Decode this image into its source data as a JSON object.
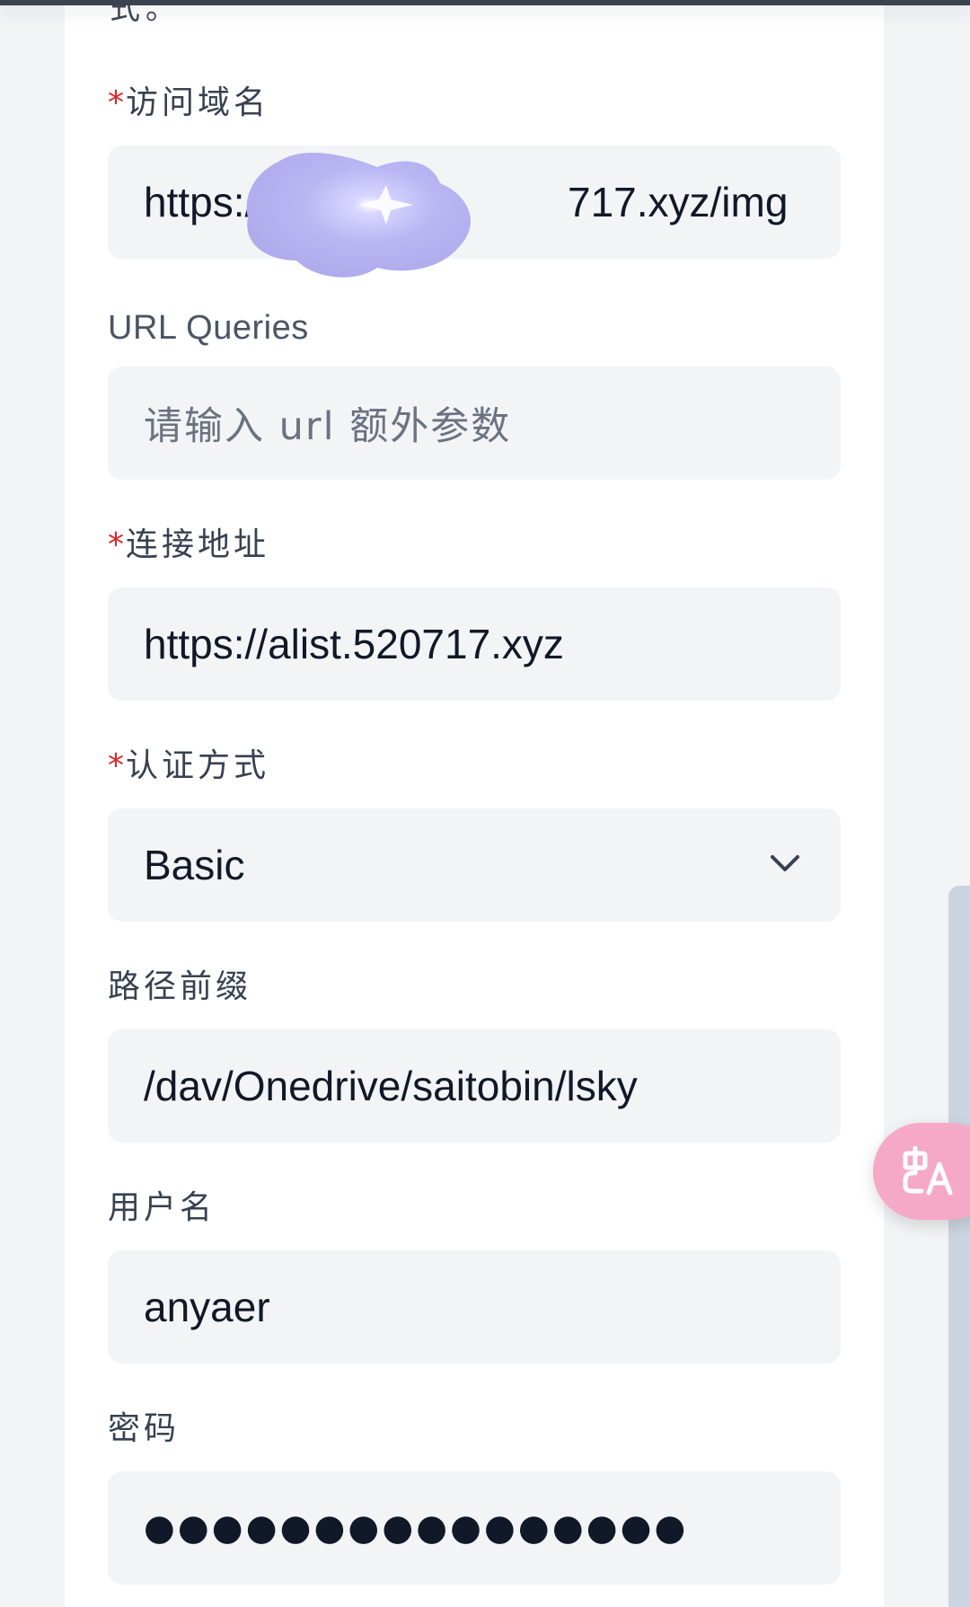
{
  "form": {
    "cut_off_text": "式。",
    "access_domain": {
      "label": "访问域名",
      "required_mark": "*",
      "value": "https://",
      "value_suffix": "717.xyz/img"
    },
    "url_queries": {
      "label": "URL Queries",
      "placeholder": "请输入 url 额外参数"
    },
    "connection_address": {
      "label": "连接地址",
      "required_mark": "*",
      "value": "https://alist.520717.xyz"
    },
    "auth_method": {
      "label": "认证方式",
      "required_mark": "*",
      "selected": "Basic",
      "icon": "chevron-down-icon"
    },
    "path_prefix": {
      "label": "路径前缀",
      "value": "/dav/Onedrive/saitobin/lsky"
    },
    "username": {
      "label": "用户名",
      "value": "anyaer"
    },
    "password": {
      "label": "密码",
      "masked_value": "●●●●●●●●●●●●●●●●"
    }
  },
  "floating": {
    "translate_icon": "translate-icon",
    "translate_color": "#f5a9c6"
  },
  "colors": {
    "required": "#dc2626",
    "field_bg": "#f3f4f6",
    "redaction": "#b4b4f0"
  }
}
